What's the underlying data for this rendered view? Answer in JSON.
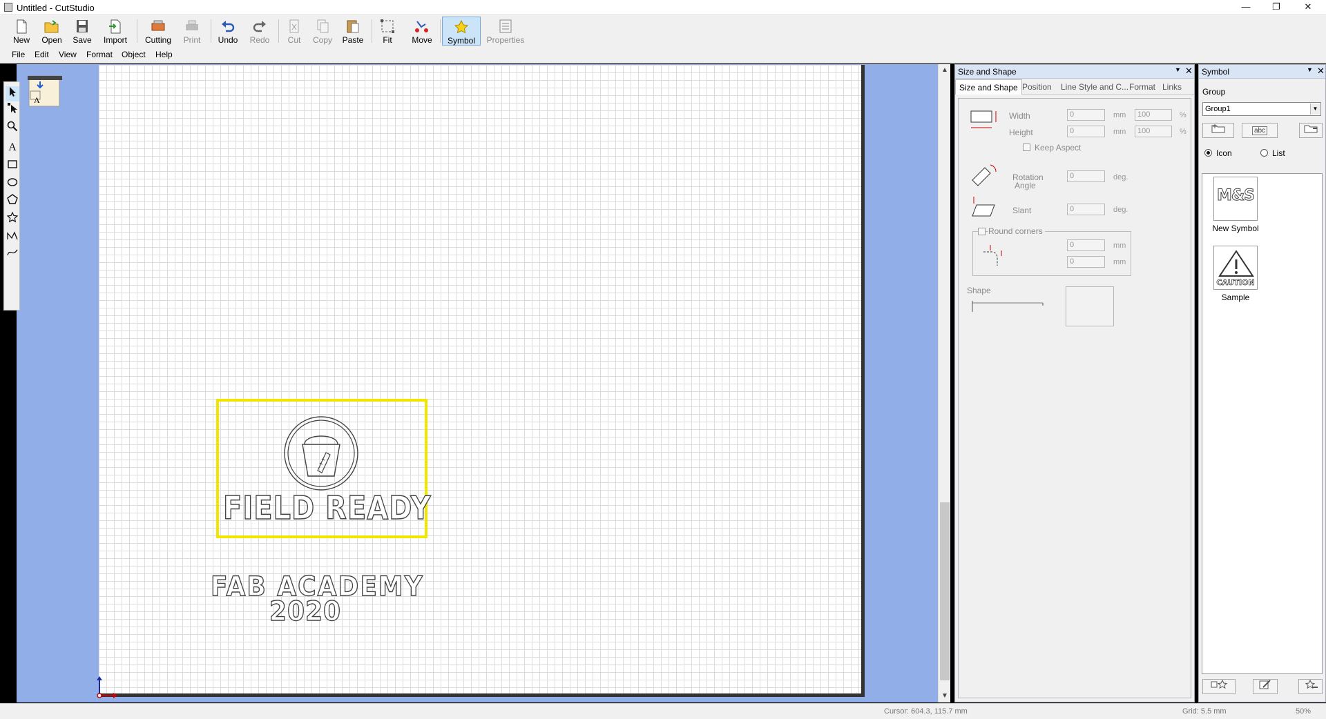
{
  "window": {
    "title": "Untitled - CutStudio",
    "minimize": "—",
    "restore": "❐",
    "close": "✕"
  },
  "toolbar": {
    "new": "New",
    "open": "Open",
    "save": "Save",
    "import": "Import",
    "cutting": "Cutting",
    "print": "Print",
    "undo": "Undo",
    "redo": "Redo",
    "cut": "Cut",
    "copy": "Copy",
    "paste": "Paste",
    "fit": "Fit",
    "move": "Move",
    "symbol": "Symbol",
    "properties": "Properties"
  },
  "menu": {
    "file": "File",
    "edit": "Edit",
    "view": "View",
    "format": "Format",
    "object": "Object",
    "help": "Help"
  },
  "canvas": {
    "logo_text": "FIELD READY",
    "text_line1": "FAB ACADEMY",
    "text_line2": "2020",
    "thumb_letter": "A"
  },
  "size_panel": {
    "title": "Size and Shape",
    "tabs": [
      "Size and Shape",
      "Position",
      "Line Style and C...",
      "Format",
      "Links"
    ],
    "width_label": "Width",
    "height_label": "Height",
    "width_value": "0",
    "height_value": "0",
    "width_pct": "100",
    "height_pct": "100",
    "unit_mm": "mm",
    "unit_pct": "%",
    "unit_deg": "deg.",
    "keep_aspect": "Keep Aspect",
    "rotation_label1": "Rotation",
    "rotation_label2": "Angle",
    "rotation_value": "0",
    "slant_label": "Slant",
    "slant_value": "0",
    "round_corners": "Round corners",
    "round_value1": "0",
    "round_value2": "0",
    "shape_label": "Shape"
  },
  "symbol_panel": {
    "title": "Symbol",
    "group_label": "Group",
    "group_value": "Group1",
    "btn_rename": "abc",
    "view_icon": "Icon",
    "view_list": "List",
    "items": [
      {
        "label": "New Symbol",
        "icon_text": "M&S"
      },
      {
        "label": "Sample",
        "icon_text": "CAUTION"
      }
    ]
  },
  "status": {
    "cursor": "Cursor: 604.3, 115.7 mm",
    "grid": "Grid: 5.5 mm",
    "zoom": "50%"
  },
  "colors": {
    "workspace": "#91aee8",
    "selection": "#f2e600",
    "panel_header": "#d9e4f5"
  }
}
